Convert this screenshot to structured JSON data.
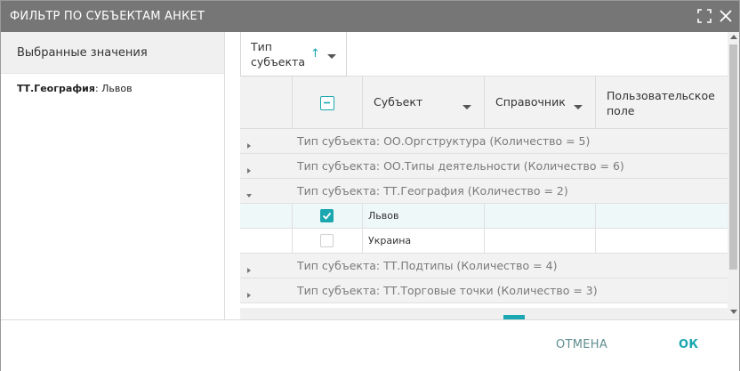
{
  "dialog": {
    "title": "ФИЛЬТР ПО СУБЪЕКТАМ АНКЕТ",
    "icons": [
      "expand-icon",
      "close-icon"
    ]
  },
  "left_pane": {
    "header": "Выбранные значения",
    "selected": {
      "key": "ТТ.География",
      "value": "Львов"
    }
  },
  "grid": {
    "group_chip": {
      "label": "Тип субъекта",
      "sort": "↑"
    },
    "columns": [
      "Субъект",
      "Справочник",
      "Пользовательское поле"
    ],
    "groups": [
      {
        "text": "Тип субъекта: ОО.Оргструктура (Количество = 5)",
        "expanded": false
      },
      {
        "text": "Тип субъекта: ОО.Типы деятельности (Количество = 6)",
        "expanded": false
      },
      {
        "text": "Тип субъекта: ТТ.География (Количество = 2)",
        "expanded": true
      },
      {
        "text": "Тип субъекта: ТТ.Подтипы (Количество = 4)",
        "expanded": false
      },
      {
        "text": "Тип субъекта: ТТ.Торговые точки (Количество = 3)",
        "expanded": false
      }
    ],
    "rows": [
      {
        "subject": "Львов",
        "checked": true
      },
      {
        "subject": "Украина",
        "checked": false
      }
    ]
  },
  "footer": {
    "cancel_label": "ОТМЕНА",
    "ok_label": "ОК"
  },
  "colors": {
    "accent": "#1aa7b0",
    "titlebar": "#767676"
  }
}
